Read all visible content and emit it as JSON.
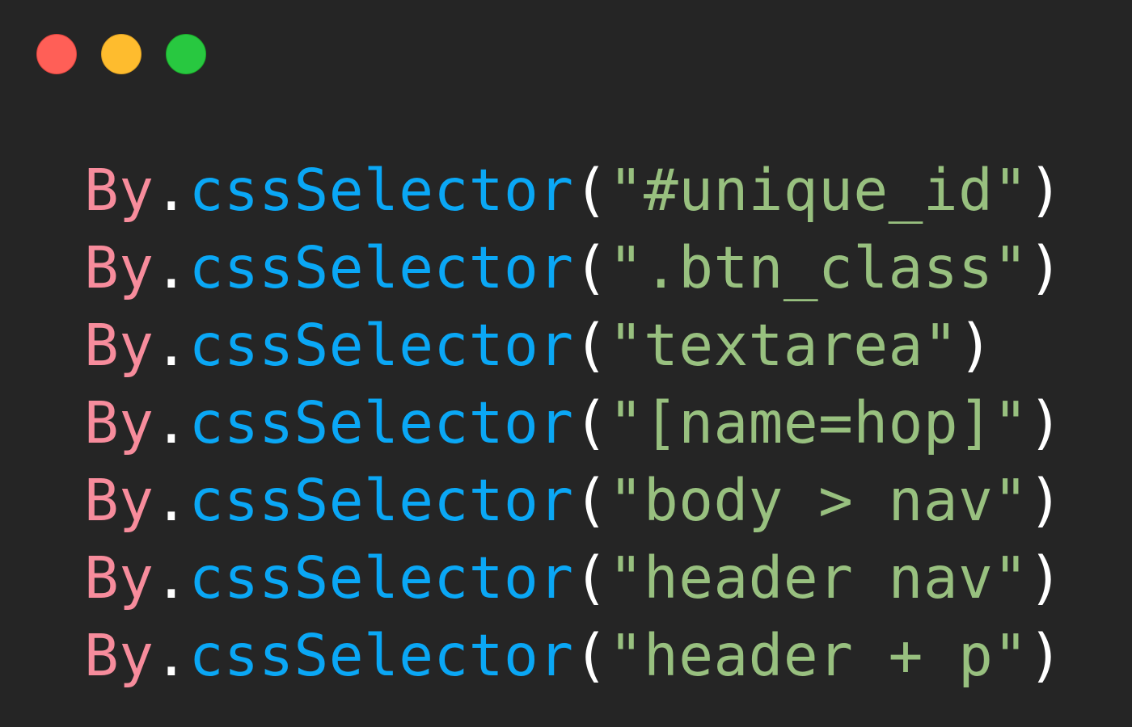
{
  "window": {
    "controls": [
      {
        "name": "close",
        "color": "#ff5f57"
      },
      {
        "name": "minimize",
        "color": "#febc2e"
      },
      {
        "name": "maximize",
        "color": "#28c840"
      }
    ]
  },
  "code": {
    "lines": [
      {
        "object": "By",
        "dot": ".",
        "method": "cssSelector",
        "open": "(",
        "string": "\"#unique_id\"",
        "close": ")"
      },
      {
        "object": "By",
        "dot": ".",
        "method": "cssSelector",
        "open": "(",
        "string": "\".btn_class\"",
        "close": ")"
      },
      {
        "object": "By",
        "dot": ".",
        "method": "cssSelector",
        "open": "(",
        "string": "\"textarea\"",
        "close": ")"
      },
      {
        "object": "By",
        "dot": ".",
        "method": "cssSelector",
        "open": "(",
        "string": "\"[name=hop]\"",
        "close": ")"
      },
      {
        "object": "By",
        "dot": ".",
        "method": "cssSelector",
        "open": "(",
        "string": "\"body > nav\"",
        "close": ")"
      },
      {
        "object": "By",
        "dot": ".",
        "method": "cssSelector",
        "open": "(",
        "string": "\"header nav\"",
        "close": ")"
      },
      {
        "object": "By",
        "dot": ".",
        "method": "cssSelector",
        "open": "(",
        "string": "\"header + p\"",
        "close": ")"
      }
    ]
  },
  "colors": {
    "background": "#252525",
    "class": "#f78c9c",
    "method": "#0aa7f5",
    "string": "#98c07f",
    "punctuation": "#ffffff"
  }
}
